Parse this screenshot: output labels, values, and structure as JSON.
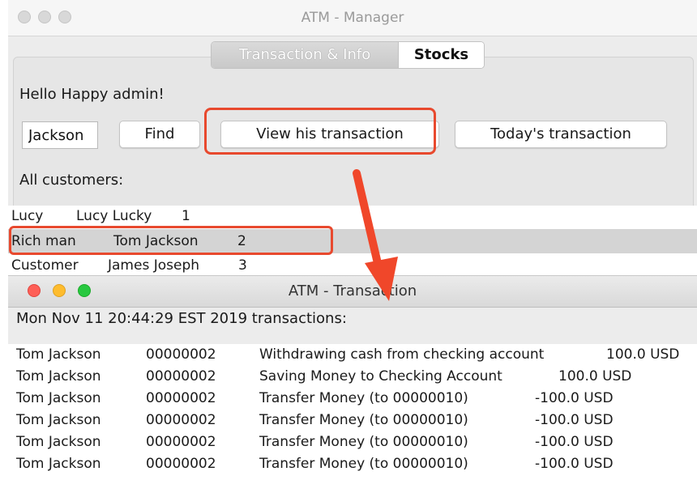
{
  "manager": {
    "window_title": "ATM - Manager",
    "tabs": [
      {
        "label": "Transaction & Info",
        "selected": false
      },
      {
        "label": "Stocks",
        "selected": true
      }
    ],
    "greeting": "Hello Happy admin!",
    "search_value": "Jackson",
    "find_label": "Find",
    "view_transaction_label": "View his transaction",
    "today_transaction_label": "Today's transaction",
    "all_customers_label": "All customers:",
    "customers": [
      {
        "type": "Lucy",
        "name": "Lucy Lucky",
        "id": "1"
      },
      {
        "type": "Rich man",
        "name": "Tom Jackson",
        "id": "2"
      },
      {
        "type": "Customer",
        "name": "James Joseph",
        "id": "3"
      }
    ]
  },
  "transaction": {
    "window_title": "ATM - Transaction",
    "header": "Mon Nov 11 20:44:29 EST 2019 transactions:",
    "rows": [
      {
        "name": "Tom Jackson",
        "account": "00000002",
        "description": "Withdrawing cash from checking account",
        "amount": "100.0 USD"
      },
      {
        "name": "Tom Jackson",
        "account": "00000002",
        "description": "Saving Money to Checking Account",
        "amount": "100.0 USD"
      },
      {
        "name": "Tom Jackson",
        "account": "00000002",
        "description": "Transfer Money (to 00000010)",
        "amount": "-100.0 USD"
      },
      {
        "name": "Tom Jackson",
        "account": "00000002",
        "description": "Transfer Money (to 00000010)",
        "amount": "-100.0 USD"
      },
      {
        "name": "Tom Jackson",
        "account": "00000002",
        "description": "Transfer Money (to 00000010)",
        "amount": "-100.0 USD"
      },
      {
        "name": "Tom Jackson",
        "account": "00000002",
        "description": "Transfer Money (to 00000010)",
        "amount": "-100.0 USD"
      }
    ]
  },
  "colors": {
    "highlight": "#e8492e",
    "selected_row": "#d4d4d4",
    "close": "#fe5f57",
    "minimize": "#febc2e",
    "zoom": "#28c840"
  },
  "annotations": [
    "highlight-box-view-button",
    "highlight-box-selected-row",
    "arrow-to-transaction-window"
  ]
}
